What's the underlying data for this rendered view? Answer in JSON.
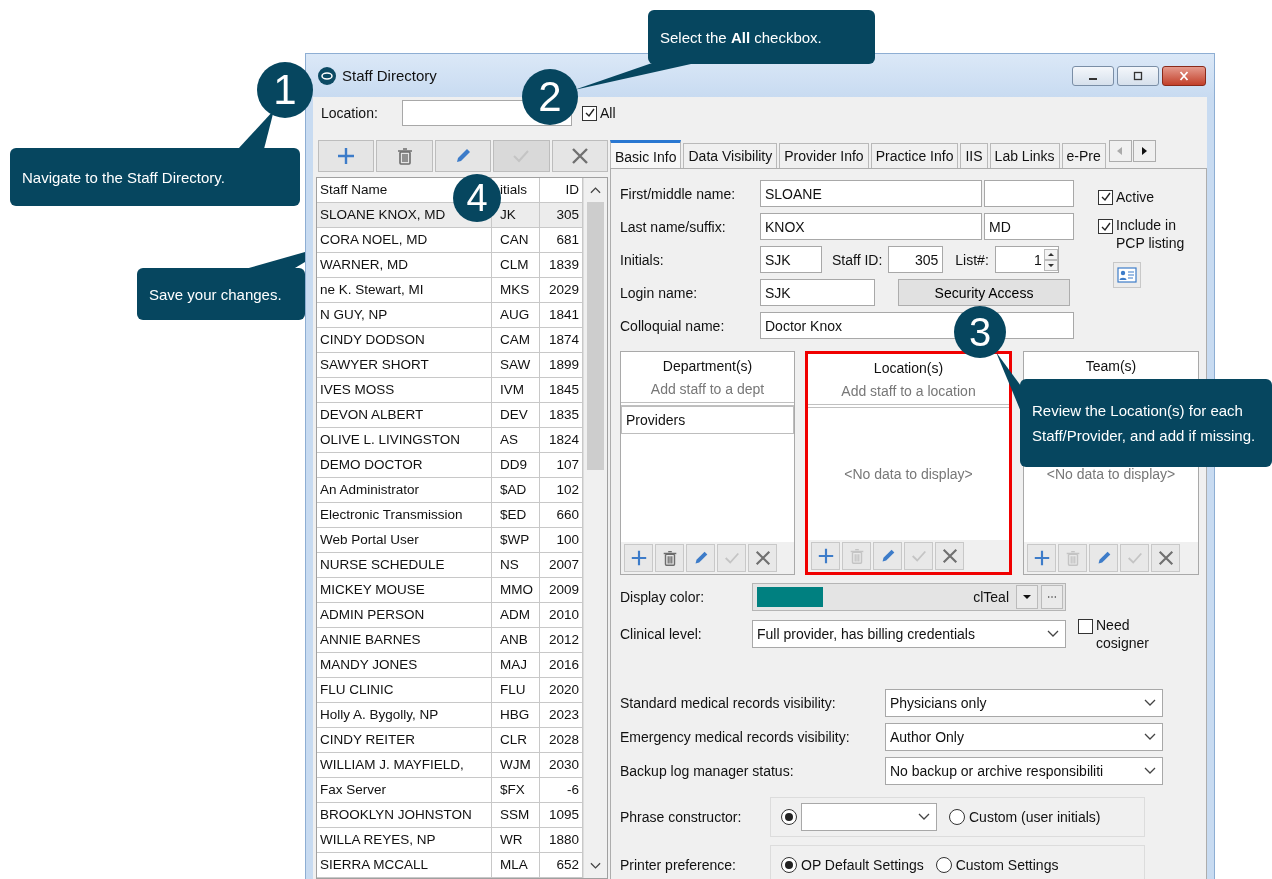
{
  "window": {
    "title": "Staff Directory"
  },
  "location_filter": {
    "label": "Location:"
  },
  "all_checkbox": {
    "label": "All",
    "checked": true
  },
  "staff_toolbar": [
    {
      "kind": "add",
      "disabled": false
    },
    {
      "kind": "delete",
      "disabled": false
    },
    {
      "kind": "edit",
      "disabled": false
    },
    {
      "kind": "save",
      "disabled": true
    },
    {
      "kind": "cancel",
      "disabled": false
    }
  ],
  "staff_table": {
    "columns": [
      "Staff Name",
      "itials",
      "ID"
    ],
    "rows": [
      {
        "cells": [
          "SLOANE KNOX, MD",
          "JK",
          "305"
        ],
        "selected": true
      },
      {
        "cells": [
          "CORA NOEL, MD",
          "CAN",
          "681"
        ],
        "selected": false
      },
      {
        "cells": [
          "WARNER, MD",
          "CLM",
          "1839"
        ],
        "selected": false
      },
      {
        "cells": [
          "ne K. Stewart, MI",
          "MKS",
          "2029"
        ],
        "selected": false
      },
      {
        "cells": [
          "N GUY, NP",
          "AUG",
          "1841"
        ],
        "selected": false
      },
      {
        "cells": [
          "CINDY DODSON",
          "CAM",
          "1874"
        ],
        "selected": false
      },
      {
        "cells": [
          "SAWYER SHORT",
          "SAW",
          "1899"
        ],
        "selected": false
      },
      {
        "cells": [
          "IVES MOSS",
          "IVM",
          "1845"
        ],
        "selected": false
      },
      {
        "cells": [
          "DEVON ALBERT",
          "DEV",
          "1835"
        ],
        "selected": false
      },
      {
        "cells": [
          "OLIVE L. LIVINGSTON",
          "AS",
          "1824"
        ],
        "selected": false
      },
      {
        "cells": [
          "DEMO DOCTOR",
          "DD9",
          "107"
        ],
        "selected": false
      },
      {
        "cells": [
          "An Administrator",
          "$AD",
          "102"
        ],
        "selected": false
      },
      {
        "cells": [
          "Electronic Transmission",
          "$ED",
          "660"
        ],
        "selected": false
      },
      {
        "cells": [
          "Web Portal User",
          "$WP",
          "100"
        ],
        "selected": false
      },
      {
        "cells": [
          "NURSE SCHEDULE",
          "NS",
          "2007"
        ],
        "selected": false
      },
      {
        "cells": [
          "MICKEY MOUSE",
          "MMO",
          "2009"
        ],
        "selected": false
      },
      {
        "cells": [
          "ADMIN PERSON",
          "ADM",
          "2010"
        ],
        "selected": false
      },
      {
        "cells": [
          "ANNIE BARNES",
          "ANB",
          "2012"
        ],
        "selected": false
      },
      {
        "cells": [
          "MANDY JONES",
          "MAJ",
          "2016"
        ],
        "selected": false
      },
      {
        "cells": [
          "FLU CLINIC",
          "FLU",
          "2020"
        ],
        "selected": false
      },
      {
        "cells": [
          "Holly A. Bygolly, NP",
          "HBG",
          "2023"
        ],
        "selected": false
      },
      {
        "cells": [
          "CINDY REITER",
          "CLR",
          "2028"
        ],
        "selected": false
      },
      {
        "cells": [
          "WILLIAM J. MAYFIELD,",
          "WJM",
          "2030"
        ],
        "selected": false
      },
      {
        "cells": [
          "Fax Server",
          "$FX",
          "-6"
        ],
        "selected": false
      },
      {
        "cells": [
          "BROOKLYN JOHNSTON",
          "SSM",
          "1095"
        ],
        "selected": false
      },
      {
        "cells": [
          "WILLA REYES, NP",
          "WR",
          "1880"
        ],
        "selected": false
      },
      {
        "cells": [
          "SIERRA MCCALL",
          "MLA",
          "652"
        ],
        "selected": false
      }
    ]
  },
  "tabs": [
    {
      "label": "Basic Info",
      "selected": true
    },
    {
      "label": "Data Visibility",
      "selected": false
    },
    {
      "label": "Provider Info",
      "selected": false
    },
    {
      "label": "Practice Info",
      "selected": false
    },
    {
      "label": "IIS",
      "selected": false
    },
    {
      "label": "Lab Links",
      "selected": false
    },
    {
      "label": "e-Pre",
      "selected": false
    }
  ],
  "basic_info": {
    "first_middle": {
      "label": "First/middle name:",
      "first": "SLOANE"
    },
    "last_suffix": {
      "label": "Last name/suffix:",
      "last": "KNOX",
      "suffix": "MD"
    },
    "initials": {
      "label": "Initials:",
      "value": "SJK"
    },
    "staff_id": {
      "label": "Staff ID:",
      "value": "305"
    },
    "list_number": {
      "label": "List#:",
      "value": "1"
    },
    "login": {
      "label": "Login name:",
      "value": "SJK"
    },
    "security_button": "Security Access",
    "colloquial": {
      "label": "Colloquial name:",
      "value": "Doctor Knox"
    },
    "active": {
      "label": "Active",
      "checked": true
    },
    "include_pcp": {
      "label": "Include in PCP listing",
      "checked": true
    },
    "panels": [
      {
        "title": "Department(s)",
        "hint": "Add staff to a dept",
        "items": [
          "Providers"
        ],
        "highlighted": false,
        "toolbar": [
          {
            "kind": "add",
            "disabled": false
          },
          {
            "kind": "delete",
            "disabled": false
          },
          {
            "kind": "edit",
            "disabled": false
          },
          {
            "kind": "save",
            "disabled": true
          },
          {
            "kind": "cancel",
            "disabled": false
          }
        ]
      },
      {
        "title": "Location(s)",
        "hint": "Add staff to a location",
        "empty_text": "<No data to display>",
        "highlighted": true,
        "toolbar": [
          {
            "kind": "add",
            "disabled": false
          },
          {
            "kind": "delete",
            "disabled": true
          },
          {
            "kind": "edit",
            "disabled": false
          },
          {
            "kind": "save",
            "disabled": true
          },
          {
            "kind": "cancel",
            "disabled": false
          }
        ]
      },
      {
        "title": "Team(s)",
        "empty_text": "<No data to display>",
        "highlighted": false,
        "toolbar": [
          {
            "kind": "add",
            "disabled": false
          },
          {
            "kind": "delete",
            "disabled": true
          },
          {
            "kind": "edit",
            "disabled": false
          },
          {
            "kind": "save",
            "disabled": true
          },
          {
            "kind": "cancel",
            "disabled": false
          }
        ]
      }
    ],
    "display_color": {
      "label": "Display color:",
      "color": "#008080",
      "value": "clTeal"
    },
    "clinical_level": {
      "label": "Clinical level:",
      "value": "Full provider, has billing credentials"
    },
    "need_cosigner": {
      "label": "Need cosigner",
      "checked": false
    },
    "selects": [
      {
        "label": "Standard medical records visibility:",
        "value": "Physicians only"
      },
      {
        "label": "Emergency medical records visibility:",
        "value": "Author Only"
      },
      {
        "label": "Backup log manager status:",
        "value": "No backup or archive responsibiliti"
      }
    ],
    "phrase_constructor": {
      "label": "Phrase constructor:",
      "options": [
        {
          "kind": "dropdown",
          "selected": true
        },
        {
          "kind": "text",
          "label": "Custom (user initials)",
          "selected": false
        }
      ]
    },
    "printer_preference": {
      "label": "Printer preference:",
      "options": [
        {
          "kind": "text",
          "label": "OP Default Settings",
          "selected": true
        },
        {
          "kind": "text",
          "label": "Custom Settings",
          "selected": false
        }
      ]
    }
  },
  "callouts": [
    {
      "number": "1",
      "text": "Navigate to the Staff Directory."
    },
    {
      "number": "2",
      "text": "Select the **All** checkbox."
    },
    {
      "number": "3",
      "text": "Review the Location(s) for each Staff/Provider, and add if missing."
    },
    {
      "number": "4",
      "text": "Save your changes."
    }
  ]
}
